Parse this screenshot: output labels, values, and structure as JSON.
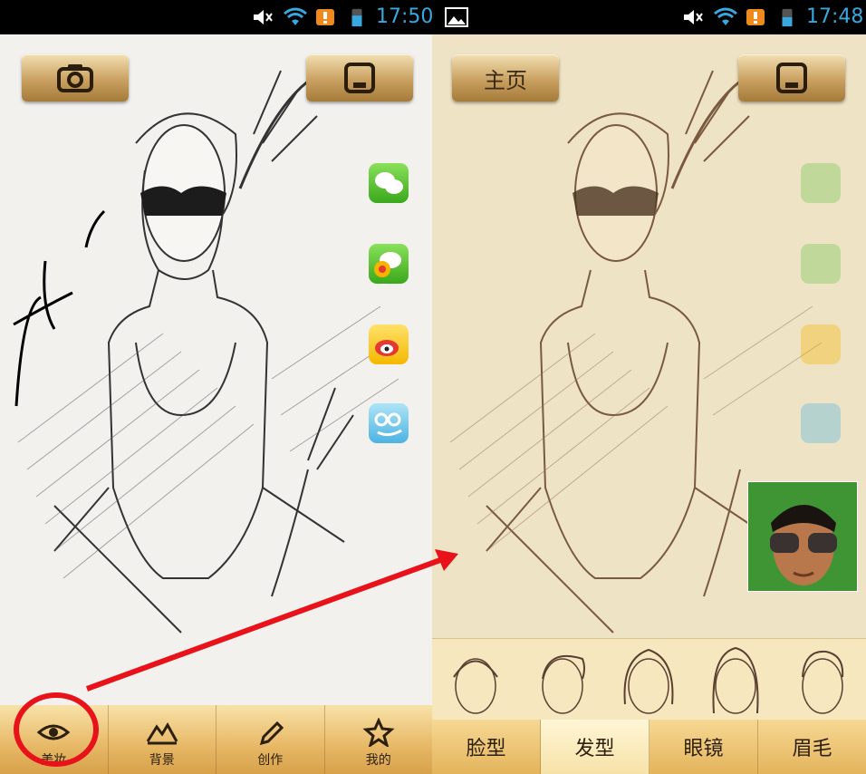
{
  "left": {
    "status": {
      "time": "17:50"
    },
    "camera_button_icon": "camera-icon",
    "save_button_icon": "save-icon",
    "share_icons": [
      "wechat-icon",
      "moments-icon",
      "weibo-icon",
      "qzone-icon"
    ],
    "nav": [
      {
        "label": "美妆",
        "icon": "eye-icon"
      },
      {
        "label": "背景",
        "icon": "mountain-icon"
      },
      {
        "label": "创作",
        "icon": "pencil-icon"
      },
      {
        "label": "我的",
        "icon": "star-icon"
      }
    ]
  },
  "right": {
    "status": {
      "time": "17:48"
    },
    "home_button": "主页",
    "save_button_icon": "save-icon",
    "tabs": [
      "脸型",
      "发型",
      "眼镜",
      "眉毛"
    ],
    "active_tab": "发型"
  },
  "colors": {
    "status_text": "#38a8e0",
    "gold": "#d7a14a",
    "annotation_red": "#e8121b"
  }
}
